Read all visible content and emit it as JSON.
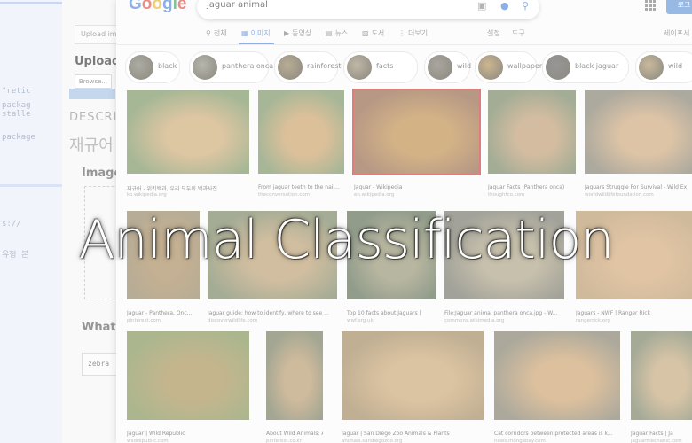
{
  "background_app": {
    "code_lines": [
      "\"retic",
      "packag",
      "stalle",
      "package"
    ],
    "code_lines_lower": [
      "s://",
      "유형 본"
    ],
    "upload_input_placeholder": "Upload image",
    "upload_heading": "Upload a",
    "browse_label": "Browse...",
    "description_heading": "DESCRIPT",
    "korean_text": "재규어",
    "image_heading": "Image",
    "what_heading": "What is",
    "answer_value": "zebra"
  },
  "browser": {
    "logo": "Google",
    "logo_letters": [
      {
        "ch": "G",
        "color": "#4a7fd6"
      },
      {
        "ch": "o",
        "color": "#d8473b"
      },
      {
        "ch": "o",
        "color": "#e6b12d"
      },
      {
        "ch": "g",
        "color": "#4a7fd6"
      },
      {
        "ch": "l",
        "color": "#3d9b55"
      },
      {
        "ch": "e",
        "color": "#d8473b"
      }
    ],
    "search_query": "jaguar animal",
    "camera_icon": "camera-icon",
    "mic_icon": "mic-icon",
    "search_icon": "search-icon",
    "login_label": "로그",
    "tabs": [
      {
        "label": "전체",
        "icon": "search-icon",
        "active": false
      },
      {
        "label": "이미지",
        "icon": "image-icon",
        "active": true
      },
      {
        "label": "동영상",
        "icon": "video-icon",
        "active": false
      },
      {
        "label": "뉴스",
        "icon": "news-icon",
        "active": false
      },
      {
        "label": "도서",
        "icon": "book-icon",
        "active": false
      },
      {
        "label": "더보기",
        "icon": "more-icon",
        "active": false
      }
    ],
    "settings_label": "설정",
    "tools_label": "도구",
    "safesearch_label": "세이프서",
    "chips": [
      "black",
      "panthera onca",
      "rainforest",
      "facts",
      "wild",
      "wallpaper",
      "black jaguar",
      "wild"
    ],
    "results": [
      {
        "title": "재규어 - 위키백과, 우리 모두의 백과사전",
        "source": "ko.wikipedia.org"
      },
      {
        "title": "From jaguar teeth to the nail...",
        "source": "theconversation.com"
      },
      {
        "title": "Jaguar - Wikipedia",
        "source": "en.wikipedia.org"
      },
      {
        "title": "Jaguar Facts (Panthera onca)",
        "source": "thoughtco.com"
      },
      {
        "title": "Jaguars Struggle For Survival - Wild Ex",
        "source": "worldwildlifefoundation.com"
      },
      {
        "title": "Jaguar - Panthera, Onc...",
        "source": "pinterest.com"
      },
      {
        "title": "Jaguar guide: how to identify, where to see ...",
        "source": "discoverwildlife.com"
      },
      {
        "title": "Top 10 facts about Jaguars |",
        "source": "wwf.org.uk"
      },
      {
        "title": "File:Jaguar animal panthera onca.jpg - W...",
        "source": "commons.wikimedia.org"
      },
      {
        "title": "Jaguars - NWF | Ranger Rick",
        "source": "rangerrick.org"
      },
      {
        "title": "Jaguar | Wild Republic",
        "source": "wildrepublic.com"
      },
      {
        "title": "About Wild Animals: A...",
        "source": "pinterest.co.kr"
      },
      {
        "title": "Jaguar | San Diego Zoo Animals & Plants",
        "source": "animals.sandiegozoo.org"
      },
      {
        "title": "Cat corridors between protected areas is k...",
        "source": "news.mongabay.com"
      },
      {
        "title": "Jaguar Facts | Ja",
        "source": "jaguarmechanic.com"
      }
    ]
  },
  "overlay_title": "Animal Classification"
}
